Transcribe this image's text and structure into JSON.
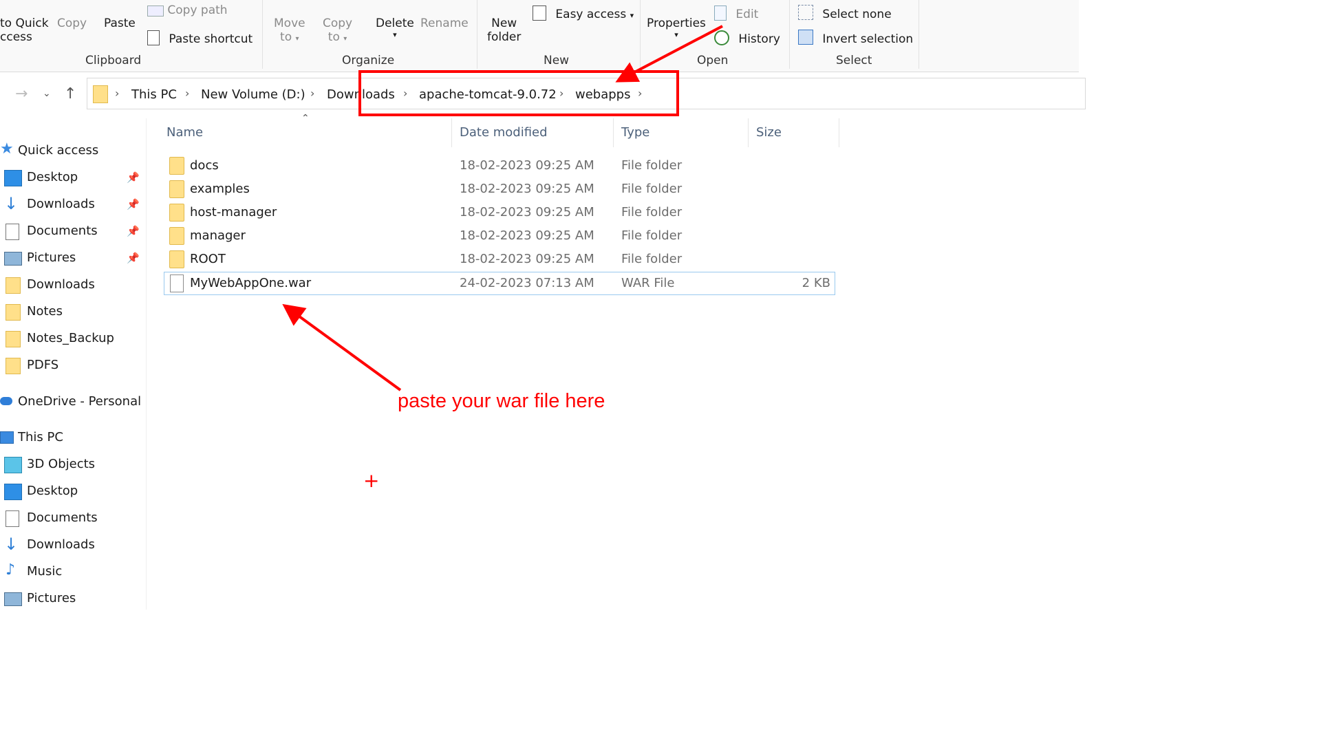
{
  "ribbon": {
    "clipboard": {
      "pin_label_1": "to Quick",
      "pin_label_2": "ccess",
      "copy": "Copy",
      "paste": "Paste",
      "copy_path": "Copy path",
      "paste_shortcut": "Paste shortcut",
      "group": "Clipboard"
    },
    "organize": {
      "move_to_1": "Move",
      "move_to_2": "to",
      "copy_to_1": "Copy",
      "copy_to_2": "to",
      "delete": "Delete",
      "rename": "Rename",
      "group": "Organize"
    },
    "new": {
      "new_folder_1": "New",
      "new_folder_2": "folder",
      "easy_access": "Easy access",
      "group": "New"
    },
    "open": {
      "properties": "Properties",
      "edit": "Edit",
      "history": "History",
      "group": "Open"
    },
    "select": {
      "select_none": "Select none",
      "invert_selection": "Invert selection",
      "group": "Select"
    }
  },
  "address": {
    "crumbs": [
      "This PC",
      "New Volume (D:)",
      "Downloads",
      "apache-tomcat-9.0.72",
      "webapps"
    ]
  },
  "sidebar": {
    "quick_access": "Quick access",
    "quick_items": [
      {
        "label": "Desktop",
        "icon": "desktop-icon",
        "pinned": true
      },
      {
        "label": "Downloads",
        "icon": "download-arrow-icon",
        "pinned": true
      },
      {
        "label": "Documents",
        "icon": "documents-icon",
        "pinned": true
      },
      {
        "label": "Pictures",
        "icon": "pictures-icon",
        "pinned": true
      },
      {
        "label": "Downloads",
        "icon": "folder-icon",
        "pinned": false
      },
      {
        "label": "Notes",
        "icon": "folder-icon",
        "pinned": false
      },
      {
        "label": "Notes_Backup",
        "icon": "folder-icon",
        "pinned": false
      },
      {
        "label": "PDFS",
        "icon": "folder-icon",
        "pinned": false
      }
    ],
    "onedrive": "OneDrive - Personal",
    "this_pc": "This PC",
    "pc_items": [
      {
        "label": "3D Objects",
        "icon": "3d-objects-icon"
      },
      {
        "label": "Desktop",
        "icon": "desktop-icon"
      },
      {
        "label": "Documents",
        "icon": "documents-icon"
      },
      {
        "label": "Downloads",
        "icon": "download-arrow-icon"
      },
      {
        "label": "Music",
        "icon": "music-icon"
      },
      {
        "label": "Pictures",
        "icon": "pictures-icon"
      }
    ]
  },
  "columns": {
    "name": "Name",
    "date": "Date modified",
    "type": "Type",
    "size": "Size"
  },
  "files": [
    {
      "name": "docs",
      "date": "18-02-2023 09:25 AM",
      "type": "File folder",
      "size": "",
      "kind": "folder"
    },
    {
      "name": "examples",
      "date": "18-02-2023 09:25 AM",
      "type": "File folder",
      "size": "",
      "kind": "folder"
    },
    {
      "name": "host-manager",
      "date": "18-02-2023 09:25 AM",
      "type": "File folder",
      "size": "",
      "kind": "folder"
    },
    {
      "name": "manager",
      "date": "18-02-2023 09:25 AM",
      "type": "File folder",
      "size": "",
      "kind": "folder"
    },
    {
      "name": "ROOT",
      "date": "18-02-2023 09:25 AM",
      "type": "File folder",
      "size": "",
      "kind": "folder"
    },
    {
      "name": "MyWebAppOne.war",
      "date": "24-02-2023 07:13 AM",
      "type": "WAR File",
      "size": "2 KB",
      "kind": "file"
    }
  ],
  "annotation": {
    "text": "paste your war file here",
    "cross": "+",
    "color": "#ff0000"
  }
}
